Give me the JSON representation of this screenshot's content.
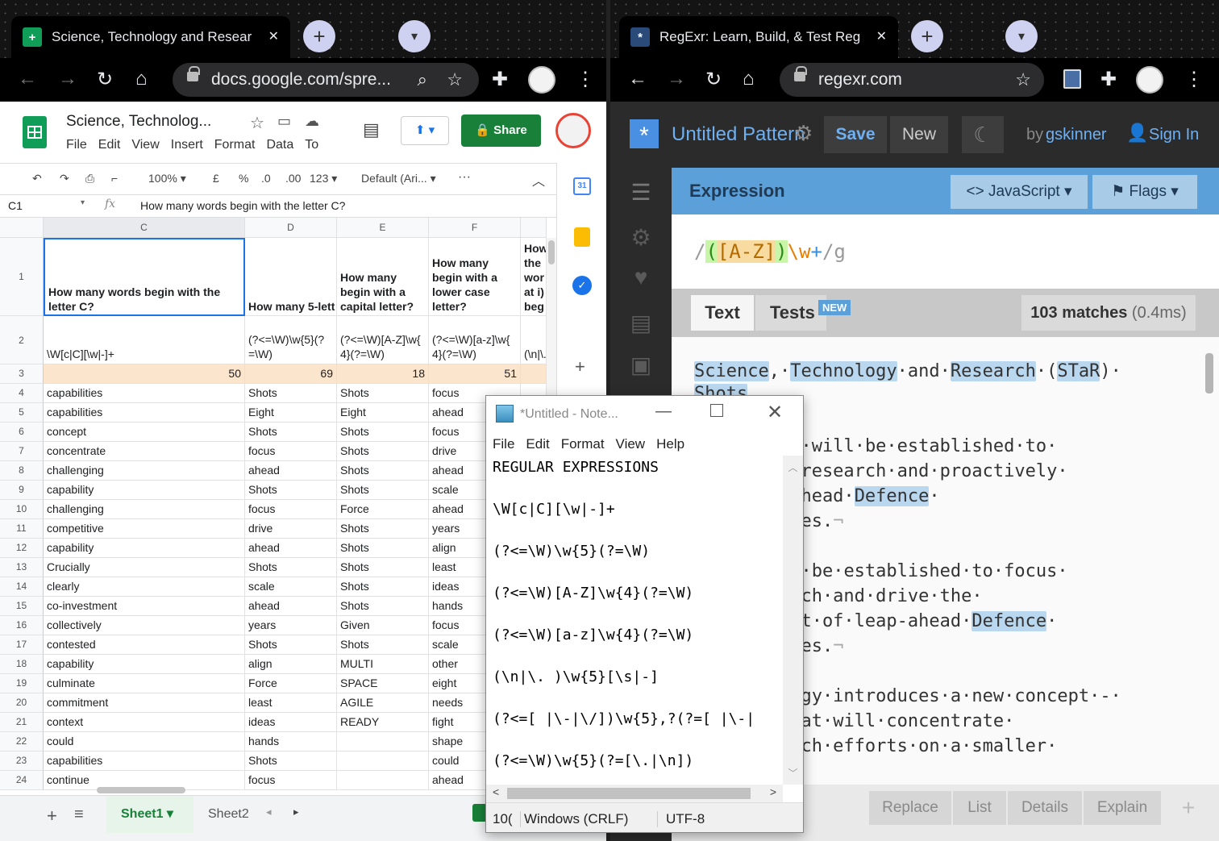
{
  "left_browser": {
    "tab_title": "Science, Technology and Resear",
    "url": "docs.google.com/spre..."
  },
  "right_browser": {
    "tab_title": "RegExr: Learn, Build, & Test Reg",
    "url": "regexr.com"
  },
  "sheets": {
    "doc_title": "Science, Technolog...",
    "menu": [
      "File",
      "Edit",
      "View",
      "Insert",
      "Format",
      "Data",
      "To"
    ],
    "share_label": "Share",
    "zoom": "100%",
    "currency": "£",
    "percent": "%",
    "dec_less": ".0",
    "dec_more": ".00",
    "num_format": "123",
    "font": "Default (Ari...",
    "more": "···",
    "name_box": "C1",
    "fx": "fx",
    "formula": "How many words begin with the letter C?",
    "columns": [
      "C",
      "D",
      "E",
      "F"
    ],
    "row1": {
      "c": [
        "How many words begin with the",
        "letter C?"
      ],
      "d": [
        "How many 5-lett"
      ],
      "e": [
        "How many",
        "begin with a",
        "capital letter?"
      ],
      "f": [
        "How many",
        "begin with a",
        "lower case",
        "letter?"
      ],
      "g": [
        "How",
        "the",
        "wor",
        "at i)",
        "beg"
      ]
    },
    "row2": {
      "c": "\\W[c|C][\\w|-]+",
      "d": [
        "(?<=\\W)\\w{5}(?",
        "=\\W)"
      ],
      "e": [
        "(?<=\\W)[A-Z]\\w{",
        "4}(?=\\W)"
      ],
      "f": [
        "(?<=\\W)[a-z]\\w{",
        "4}(?=\\W)"
      ],
      "g": "(\\n|\\."
    },
    "row3": [
      "50",
      "69",
      "18",
      "51"
    ],
    "rows": [
      [
        "4",
        "capabilities",
        "Shots",
        "Shots",
        "focus"
      ],
      [
        "5",
        "capabilities",
        "Eight",
        "Eight",
        "ahead"
      ],
      [
        "6",
        "concept",
        "Shots",
        "Shots",
        "focus"
      ],
      [
        "7",
        "concentrate",
        "focus",
        "Shots",
        "drive"
      ],
      [
        "8",
        "challenging",
        "ahead",
        "Shots",
        "ahead"
      ],
      [
        "9",
        "capability",
        "Shots",
        "Shots",
        "scale"
      ],
      [
        "10",
        "challenging",
        "focus",
        "Force",
        "ahead"
      ],
      [
        "11",
        "competitive",
        "drive",
        "Shots",
        "years"
      ],
      [
        "12",
        "capability",
        "ahead",
        "Shots",
        "align"
      ],
      [
        "13",
        "Crucially",
        "Shots",
        "Shots",
        "least"
      ],
      [
        "14",
        "clearly",
        "scale",
        "Shots",
        "ideas"
      ],
      [
        "15",
        "co-investment",
        "ahead",
        "Shots",
        "hands"
      ],
      [
        "16",
        "collectively",
        "years",
        "Given",
        "focus"
      ],
      [
        "17",
        "contested",
        "Shots",
        "Shots",
        "scale"
      ],
      [
        "18",
        "capability",
        "align",
        "MULTI",
        "other"
      ],
      [
        "19",
        "culminate",
        "Force",
        "SPACE",
        "eight"
      ],
      [
        "20",
        "commitment",
        "least",
        "AGILE",
        "needs"
      ],
      [
        "21",
        "context",
        "ideas",
        "READY",
        "fight"
      ],
      [
        "22",
        "could",
        "hands",
        "",
        "shape"
      ],
      [
        "23",
        "capabilities",
        "Shots",
        "",
        "could"
      ],
      [
        "24",
        "continue",
        "focus",
        "",
        "ahead"
      ]
    ],
    "sheet_tabs": [
      "Sheet1",
      "Sheet2"
    ]
  },
  "notepad": {
    "title": "*Untitled - Note...",
    "menu": [
      "File",
      "Edit",
      "Format",
      "View",
      "Help"
    ],
    "lines": [
      "REGULAR EXPRESSIONS",
      "\\W[c|C][\\w|-]+",
      "(?<=\\W)\\w{5}(?=\\W)",
      "(?<=\\W)[A-Z]\\w{4}(?=\\W)",
      "(?<=\\W)[a-z]\\w{4}(?=\\W)",
      "(\\n|\\. )\\w{5}[\\s|-]",
      "(?<=[ |\\-|\\/])\\w{5},?(?=[ |\\-|",
      "(?<=\\W)\\w{5}(?=[\\.|\\n])"
    ],
    "status": [
      "10(",
      "Windows (CRLF)",
      "UTF-8"
    ]
  },
  "regexr": {
    "title": "Untitled Pattern",
    "save": "Save",
    "new": "New",
    "by": "by",
    "author": "gskinner",
    "signin": "Sign In",
    "expression_label": "Expression",
    "flavor": "JavaScript ▾",
    "flags": "Flags ▾",
    "expr": {
      "open": "/",
      "g1o": "(",
      "cls": "[A-Z]",
      "g1c": ")",
      "esc": "\\w",
      "q": "+",
      "close": "/g"
    },
    "text_tab": "Text",
    "tests_tab": "Tests",
    "new_badge": "NEW",
    "matches": "103 matches",
    "time": "(0.4ms)",
    "bottom": [
      "Replace",
      "List",
      "Details",
      "Explain"
    ],
    "colors": {
      "accent": "#4a90e2",
      "highlight": "#b9d7ef"
    }
  }
}
